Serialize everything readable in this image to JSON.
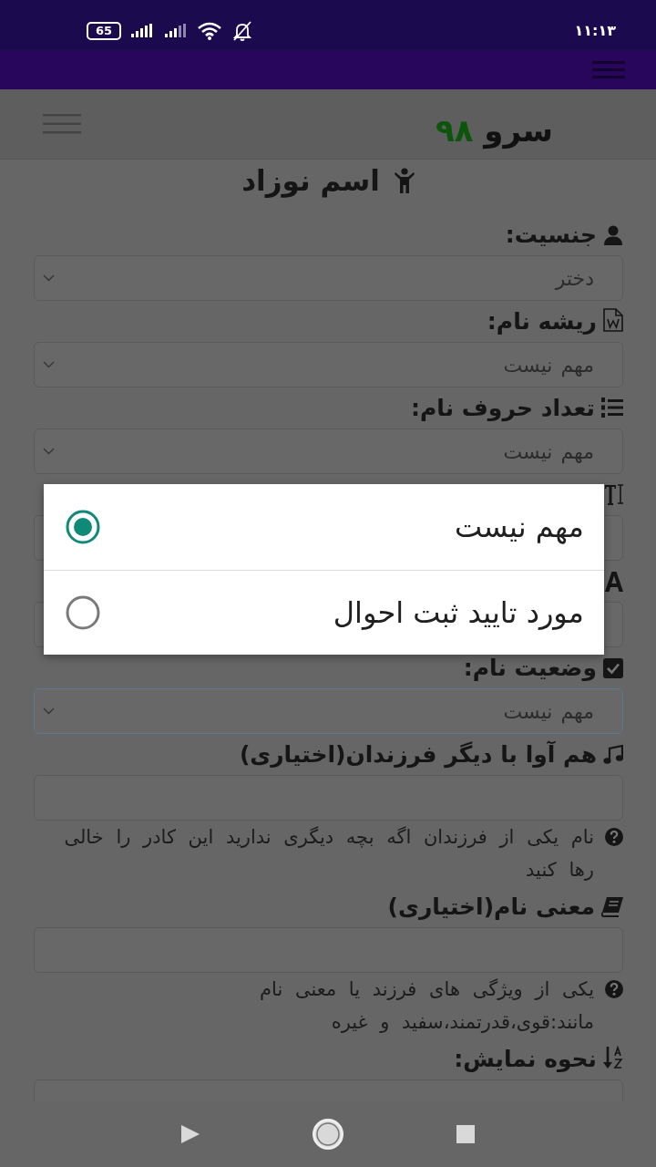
{
  "status_bar": {
    "battery": "65",
    "time": "۱۱:۱۳"
  },
  "header": {
    "logo": {
      "name": "سرو",
      "number": "۹۸"
    }
  },
  "page_title": "اسم نوزاد",
  "form": {
    "fields": [
      {
        "kind": "select",
        "label": "جنسیت:",
        "value": "دختر",
        "focused": false
      },
      {
        "kind": "select",
        "label": "ریشه نام:",
        "value": "مهم نیست",
        "focused": false
      },
      {
        "kind": "select",
        "label": "تعداد حروف نام:",
        "value": "مهم نیست",
        "focused": false
      },
      {
        "kind": "select",
        "focused": false
      },
      {
        "kind": "select",
        "focused": false
      },
      {
        "kind": "select",
        "label": "وضعیت نام:",
        "value": "مهم نیست",
        "focused": true
      },
      {
        "kind": "input",
        "label": "هم آوا با دیگر فرزندان(اختیاری)",
        "help": "نام یکی از فرزندان اگه بچه دیگری ندارید این کادر را خالی رها کنید",
        "focused": false
      },
      {
        "kind": "input",
        "label": "معنی نام(اختیاری)",
        "help": "یکی از ویژگی های فرزند یا معنی نام مانند:قوی،قدرتمند،سفید و غیره",
        "focused": false
      },
      {
        "kind": "select",
        "label": "نحوه نمایش:",
        "focused": false
      }
    ]
  },
  "dialog": {
    "options": [
      {
        "label": "مهم نیست",
        "selected": true
      },
      {
        "label": "مورد تایید ثبت احوال",
        "selected": false
      }
    ]
  }
}
